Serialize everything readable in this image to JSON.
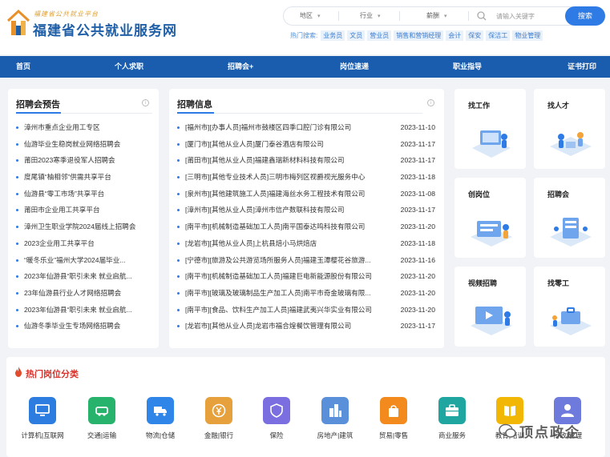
{
  "header": {
    "logo_small": "福建省公共就业平台",
    "logo_title": "福建省公共就业服务网",
    "search": {
      "region": "地区",
      "industry": "行业",
      "salary": "薪酬",
      "placeholder": "请输入关键字",
      "button": "搜索"
    },
    "hot_label": "热门搜索:",
    "hot_keywords": [
      "业务员",
      "文员",
      "营业员",
      "销售和营销经理",
      "会计",
      "保安",
      "保洁工",
      "物业管理"
    ]
  },
  "nav": [
    "首页",
    "个人求职",
    "招聘会+",
    "岗位速递",
    "职业指导",
    "证书打印"
  ],
  "fairs": {
    "title": "招聘会预告",
    "items": [
      "漳州市重点企业用工专区",
      "仙游毕业生稳岗就业网络招聘会",
      "莆田2023寒季退役军人招聘会",
      "度尾镇“柚相邻”供需共享平台",
      "仙游县“零工市场”共享平台",
      "莆田市企业用工共享平台",
      "漳州卫生职业学院2024届线上招聘会",
      "2023企业用工共享平台",
      "“暖冬乐业”福州大学2024届毕业...",
      "2023年仙游县“职引未来 就业启航...",
      "23年仙游县行业人才网络招聘会",
      "2023年仙游县“职引未来 就业启航...",
      "仙游冬季毕业生专场网络招聘会"
    ]
  },
  "jobs": {
    "title": "招聘信息",
    "items": [
      {
        "name": "[福州市][办事人员]福州市鼓楼区四季口腔门诊有限公司",
        "date": "2023-11-10"
      },
      {
        "name": "[厦门市][其他从业人员]厦门泰谷酒店有限公司",
        "date": "2023-11-17"
      },
      {
        "name": "[莆田市][其他从业人员]福建鑫瑞新材料科技有限公司",
        "date": "2023-11-17"
      },
      {
        "name": "[三明市][其他专业技术人员]三明市梅列区视爵视光服务中心",
        "date": "2023-11-18"
      },
      {
        "name": "[泉州市][其他建筑施工人员]福建海丝水务工程技术有限公司",
        "date": "2023-11-08"
      },
      {
        "name": "[漳州市][其他从业人员]漳州市信产数联科技有限公司",
        "date": "2023-11-17"
      },
      {
        "name": "[南平市][机械制造基础加工人员]南平国泰达鸣科技有限公司",
        "date": "2023-11-20"
      },
      {
        "name": "[龙岩市][其他从业人员]上杭县焙小马烘焙店",
        "date": "2023-11-18"
      },
      {
        "name": "[宁德市][旅游及公共游览场所服务人员]福建玉潭樱花谷旅游...",
        "date": "2023-11-16"
      },
      {
        "name": "[南平市][机械制造基础加工人员]福建巨电新能源股份有限公司",
        "date": "2023-11-20"
      },
      {
        "name": "[南平市][玻璃及玻璃制品生产加工人员]南平市奇金玻璃有限...",
        "date": "2023-11-20"
      },
      {
        "name": "[南平市][食品、饮料生产加工人员]福建武夷兴华实业有限公司",
        "date": "2023-11-20"
      },
      {
        "name": "[龙岩市][其他从业人员]龙岩市福合煌餐饮管理有限公司",
        "date": "2023-11-17"
      }
    ]
  },
  "tiles": [
    "找工作",
    "找人才",
    "创岗位",
    "招聘会",
    "视频招聘",
    "找零工"
  ],
  "categories": {
    "title": "热门岗位分类",
    "items": [
      {
        "label": "计算机|互联网",
        "color": "#2d7de0",
        "icon": "computer-icon"
      },
      {
        "label": "交通|运输",
        "color": "#27b36b",
        "icon": "car-icon"
      },
      {
        "label": "物流|仓储",
        "color": "#2f86e8",
        "icon": "truck-icon"
      },
      {
        "label": "金融|银行",
        "color": "#e6a03c",
        "icon": "yen-icon"
      },
      {
        "label": "保险",
        "color": "#7a6ee0",
        "icon": "shield-icon"
      },
      {
        "label": "房地产|建筑",
        "color": "#5a8fd9",
        "icon": "building-icon"
      },
      {
        "label": "贸易|零售",
        "color": "#f28a1e",
        "icon": "bag-icon"
      },
      {
        "label": "商业服务",
        "color": "#20a6a0",
        "icon": "briefcase-icon"
      },
      {
        "label": "教育|培训",
        "color": "#f2b705",
        "icon": "book-icon"
      },
      {
        "label": "行政|管理",
        "color": "#6e7bdc",
        "icon": "person-icon"
      }
    ]
  },
  "watermark": "顶点政企"
}
